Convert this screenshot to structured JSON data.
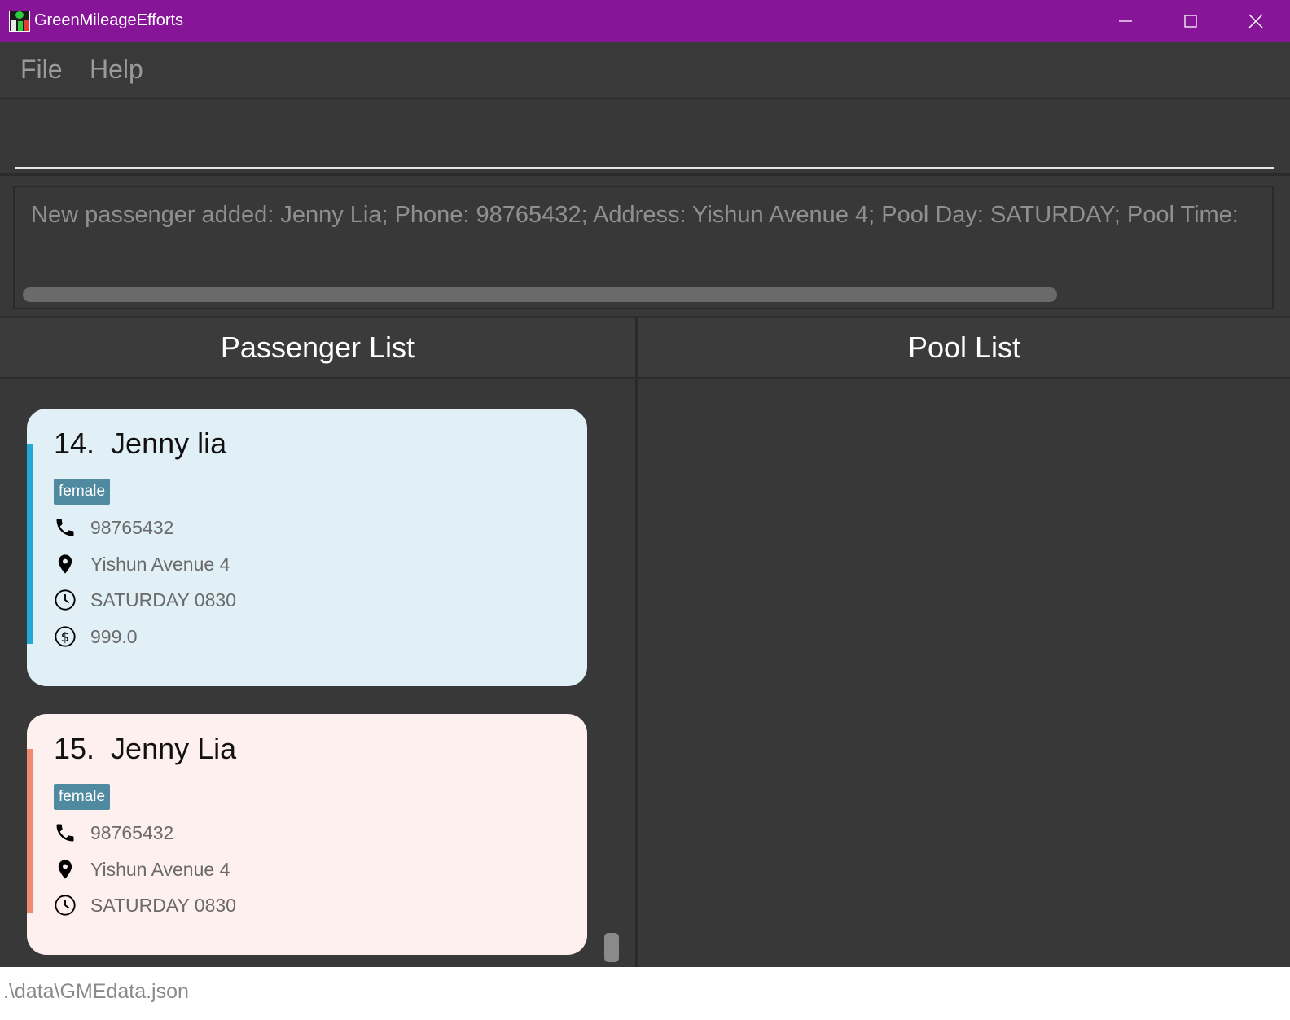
{
  "window": {
    "title": "GreenMileageEfforts",
    "controls": [
      "minimize-icon",
      "maximize-icon",
      "close-icon"
    ]
  },
  "menu": {
    "file": "File",
    "help": "Help"
  },
  "command": {
    "value": "",
    "placeholder": ""
  },
  "result": {
    "text": "New passenger added: Jenny Lia; Phone: 98765432; Address: Yishun Avenue 4; Pool Day: SATURDAY; Pool Time:"
  },
  "panels": {
    "passenger_title": "Passenger List",
    "pool_title": "Pool List"
  },
  "passengers": [
    {
      "index_name": "14.  Jenny lia",
      "tag": "female",
      "phone": "98765432",
      "address": "Yishun Avenue 4",
      "pool": "SATURDAY 0830",
      "price": "999.0",
      "color": "#e1f0f6",
      "accent": "#22a8d6"
    },
    {
      "index_name": "15.  Jenny Lia",
      "tag": "female",
      "phone": "98765432",
      "address": "Yishun Avenue 4",
      "pool": "SATURDAY 0830",
      "color": "#fef0ef",
      "accent": "#f08a70"
    }
  ],
  "status": {
    "path": ".\\data\\GMEdata.json"
  },
  "colors": {
    "titlebar": "#861597",
    "background": "#383838",
    "tag": "#4f8aa0"
  }
}
